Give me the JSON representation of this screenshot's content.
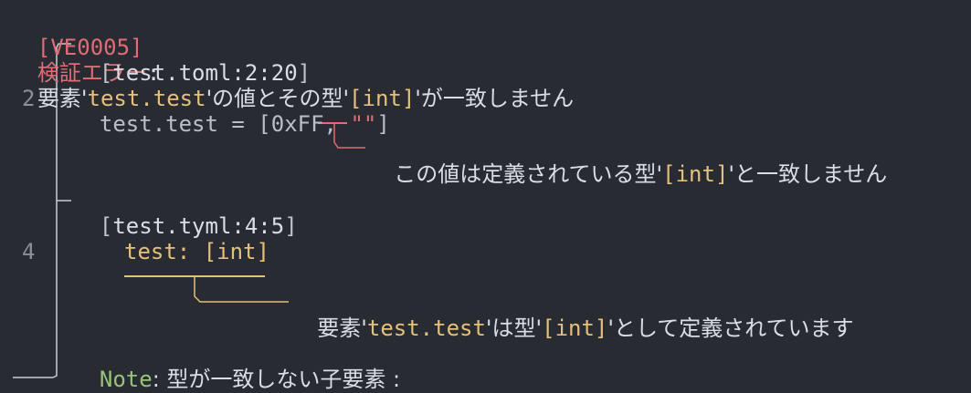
{
  "header": {
    "code": "[VE0005]",
    "title": "検証エラー",
    "colon": ":",
    "msg_pre": "要素'",
    "key": "test.test",
    "msg_mid": "'の値とその型'",
    "type": "[int]",
    "msg_post": "'が一致しません"
  },
  "loc1": {
    "open": "[",
    "path": "test.toml:2:20",
    "close": "]",
    "line_num": "2",
    "code_pre": "test.test = [0xFF, ",
    "code_str": "\"\"",
    "code_post": "]",
    "ann_pre": "この値は定義されている型'",
    "ann_type": "[int]",
    "ann_post": "'と一致しません"
  },
  "loc2": {
    "open": "[",
    "path": "test.tyml:4:5",
    "close": "]",
    "line_num": "4",
    "code": "test: [int]",
    "ann_pre": "要素'",
    "ann_key": "test.test",
    "ann_mid": "'は型'",
    "ann_type": "[int]",
    "ann_post": "'として定義されています"
  },
  "note": {
    "label": "Note",
    "text": ": 型が一致しない子要素 :"
  },
  "colors": {
    "background": "#282b32",
    "error": "#e06c75",
    "highlight": "#e5c07b",
    "note": "#98c379",
    "frame": "#c8ccd4"
  }
}
